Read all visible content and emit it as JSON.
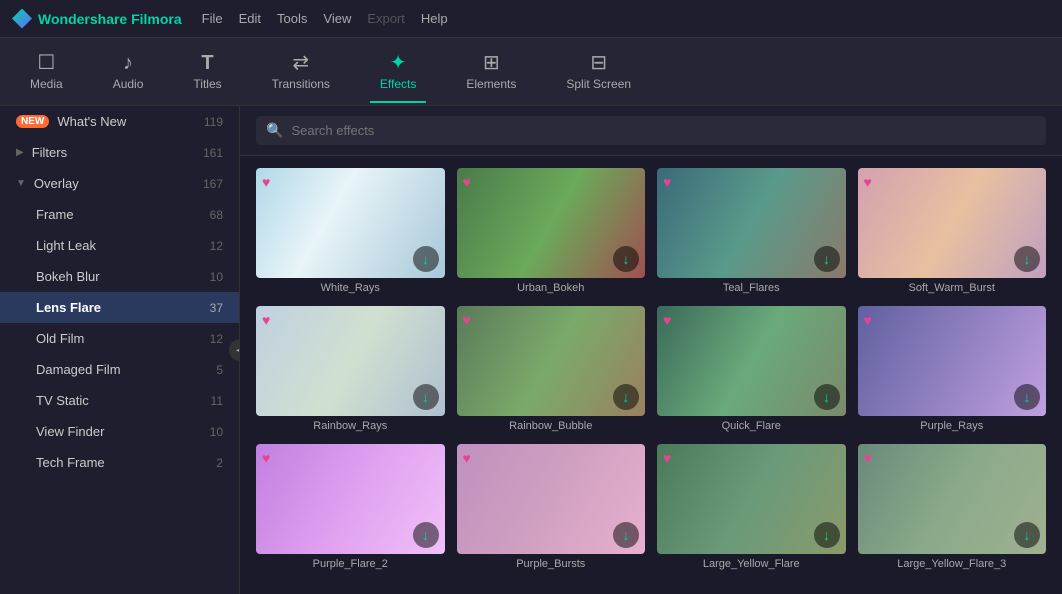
{
  "app": {
    "name": "Wondershare Filmora",
    "logo_symbol": "◆"
  },
  "menubar": {
    "items": [
      "File",
      "Edit",
      "Tools",
      "View",
      "Export",
      "Help"
    ],
    "disabled": [
      "Export"
    ]
  },
  "nav_tabs": [
    {
      "id": "media",
      "label": "Media",
      "icon": "☐"
    },
    {
      "id": "audio",
      "label": "Audio",
      "icon": "♪"
    },
    {
      "id": "titles",
      "label": "Titles",
      "icon": "T"
    },
    {
      "id": "transitions",
      "label": "Transitions",
      "icon": "⇄"
    },
    {
      "id": "effects",
      "label": "Effects",
      "icon": "✦",
      "active": true
    },
    {
      "id": "elements",
      "label": "Elements",
      "icon": "⊞"
    },
    {
      "id": "splitscreen",
      "label": "Split Screen",
      "icon": "⊟"
    }
  ],
  "sidebar": {
    "items": [
      {
        "id": "whats-new",
        "label": "What's New",
        "count": "119",
        "badge": "NEW",
        "indent": 0,
        "expanded": false
      },
      {
        "id": "filters",
        "label": "Filters",
        "count": "161",
        "indent": 0,
        "expanded": false,
        "chevron": "▶"
      },
      {
        "id": "overlay",
        "label": "Overlay",
        "count": "167",
        "indent": 0,
        "expanded": true,
        "chevron": "▼"
      },
      {
        "id": "frame",
        "label": "Frame",
        "count": "68",
        "indent": 1
      },
      {
        "id": "light-leak",
        "label": "Light Leak",
        "count": "12",
        "indent": 1
      },
      {
        "id": "bokeh-blur",
        "label": "Bokeh Blur",
        "count": "10",
        "indent": 1
      },
      {
        "id": "lens-flare",
        "label": "Lens Flare",
        "count": "37",
        "indent": 1,
        "selected": true
      },
      {
        "id": "old-film",
        "label": "Old Film",
        "count": "12",
        "indent": 1
      },
      {
        "id": "damaged-film",
        "label": "Damaged Film",
        "count": "5",
        "indent": 1
      },
      {
        "id": "tv-static",
        "label": "TV Static",
        "count": "11",
        "indent": 1
      },
      {
        "id": "view-finder",
        "label": "View Finder",
        "count": "10",
        "indent": 1
      },
      {
        "id": "tech-frame",
        "label": "Tech Frame",
        "count": "2",
        "indent": 1
      }
    ]
  },
  "search": {
    "placeholder": "Search effects"
  },
  "effects_grid": {
    "items": [
      {
        "id": "white-rays",
        "name": "White_Rays",
        "thumb_class": "thumb-white-rays"
      },
      {
        "id": "urban-bokeh",
        "name": "Urban_Bokeh",
        "thumb_class": "thumb-urban-bokeh"
      },
      {
        "id": "teal-flares",
        "name": "Teal_Flares",
        "thumb_class": "thumb-teal-flares"
      },
      {
        "id": "soft-warm-burst",
        "name": "Soft_Warm_Burst",
        "thumb_class": "thumb-soft-warm"
      },
      {
        "id": "rainbow-rays",
        "name": "Rainbow_Rays",
        "thumb_class": "thumb-rainbow-rays"
      },
      {
        "id": "rainbow-bubble",
        "name": "Rainbow_Bubble",
        "thumb_class": "thumb-rainbow-bubble"
      },
      {
        "id": "quick-flare",
        "name": "Quick_Flare",
        "thumb_class": "thumb-quick-flare"
      },
      {
        "id": "purple-rays",
        "name": "Purple_Rays",
        "thumb_class": "thumb-purple-rays"
      },
      {
        "id": "purple-flare2",
        "name": "Purple_Flare_2",
        "thumb_class": "thumb-purple-flare2"
      },
      {
        "id": "purple-bursts",
        "name": "Purple_Bursts",
        "thumb_class": "thumb-purple-bursts"
      },
      {
        "id": "large-yellow-flare",
        "name": "Large_Yellow_Flare",
        "thumb_class": "thumb-large-yellow"
      },
      {
        "id": "large-yellow-flare3",
        "name": "Large_Yellow_Flare_3",
        "thumb_class": "thumb-large-yellow3"
      }
    ]
  },
  "icons": {
    "heart": "♥",
    "download": "↓",
    "search": "🔍",
    "collapse": "◀"
  },
  "colors": {
    "accent": "#00d4aa",
    "heart": "#e84393",
    "sidebar_selected_bg": "#2a3a5e",
    "badge_bg": "#ff8c00"
  }
}
